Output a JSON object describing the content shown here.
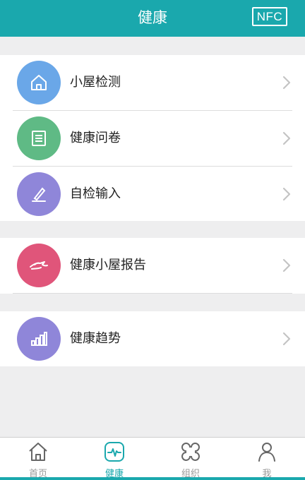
{
  "header": {
    "title": "健康",
    "nfc_label": "NFC"
  },
  "menu": {
    "items": [
      {
        "label": "小屋检测",
        "icon": "house-icon",
        "color": "#6aa7e8"
      },
      {
        "label": "健康问卷",
        "icon": "questionnaire-icon",
        "color": "#5fba85"
      },
      {
        "label": "自检输入",
        "icon": "pen-icon",
        "color": "#8f86d9"
      },
      {
        "label": "健康小屋报告",
        "icon": "hand-icon",
        "color": "#e0557a"
      },
      {
        "label": "健康趋势",
        "icon": "bar-chart-icon",
        "color": "#8f86d9"
      }
    ]
  },
  "tabs": [
    {
      "label": "首页",
      "icon": "home-icon",
      "active": false
    },
    {
      "label": "健康",
      "icon": "heartbeat-icon",
      "active": true
    },
    {
      "label": "组织",
      "icon": "organization-icon",
      "active": false
    },
    {
      "label": "我",
      "icon": "person-icon",
      "active": false
    }
  ],
  "colors": {
    "accent": "#1aa8ad",
    "background": "#eeeeef",
    "inactive_tab": "#999999"
  }
}
